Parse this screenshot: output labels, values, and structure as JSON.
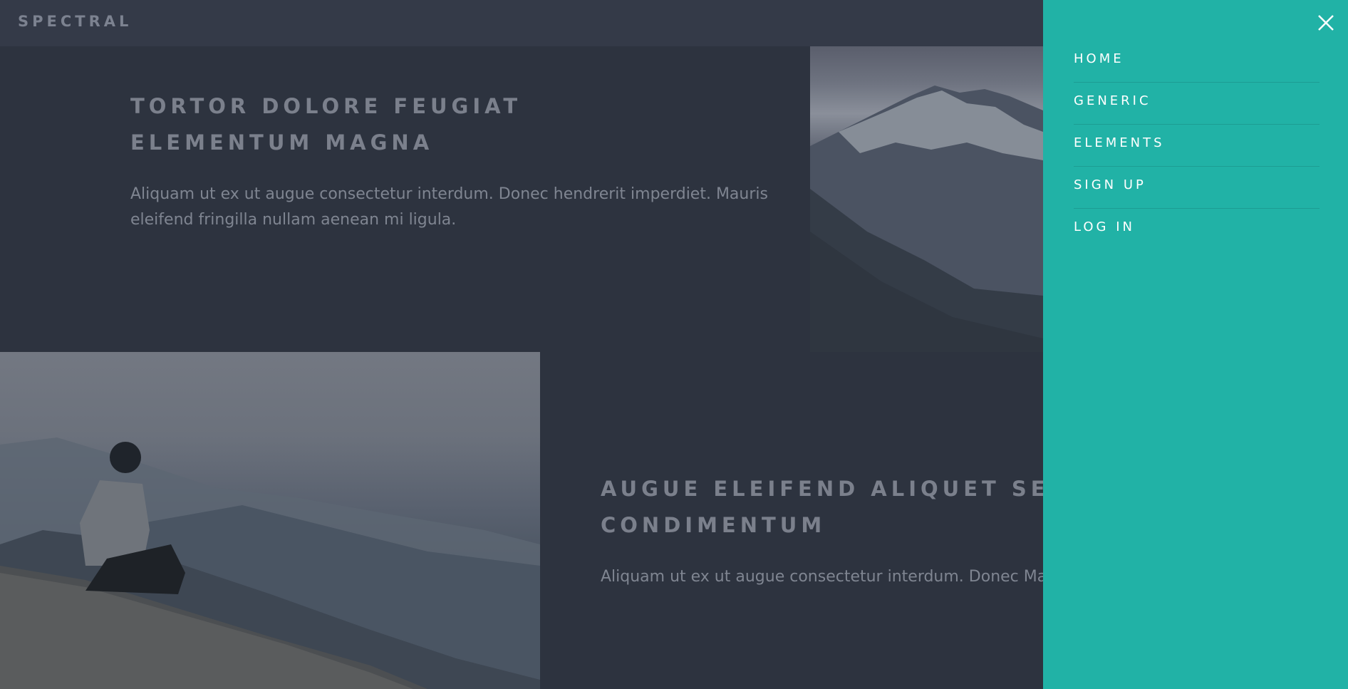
{
  "header": {
    "brand": "SPECTRAL"
  },
  "spotlights": [
    {
      "title": "TORTOR DOLORE FEUGIAT ELEMENTUM MAGNA",
      "text": "Aliquam ut ex ut augue consectetur interdum. Donec hendrerit imperdiet. Mauris eleifend fringilla nullam aenean mi ligula."
    },
    {
      "title": "AUGUE ELEIFEND ALIQUET SED CONDIMENTUM",
      "text": "Aliquam ut ex ut augue consectetur interdum. Donec Mauris eleifend fringilla nullam aenean mi ligula."
    }
  ],
  "menu": {
    "items": [
      "HOME",
      "GENERIC",
      "ELEMENTS",
      "SIGN UP",
      "LOG IN"
    ],
    "accent_color": "#21b2a6"
  },
  "icons": {
    "close": "close-icon"
  }
}
